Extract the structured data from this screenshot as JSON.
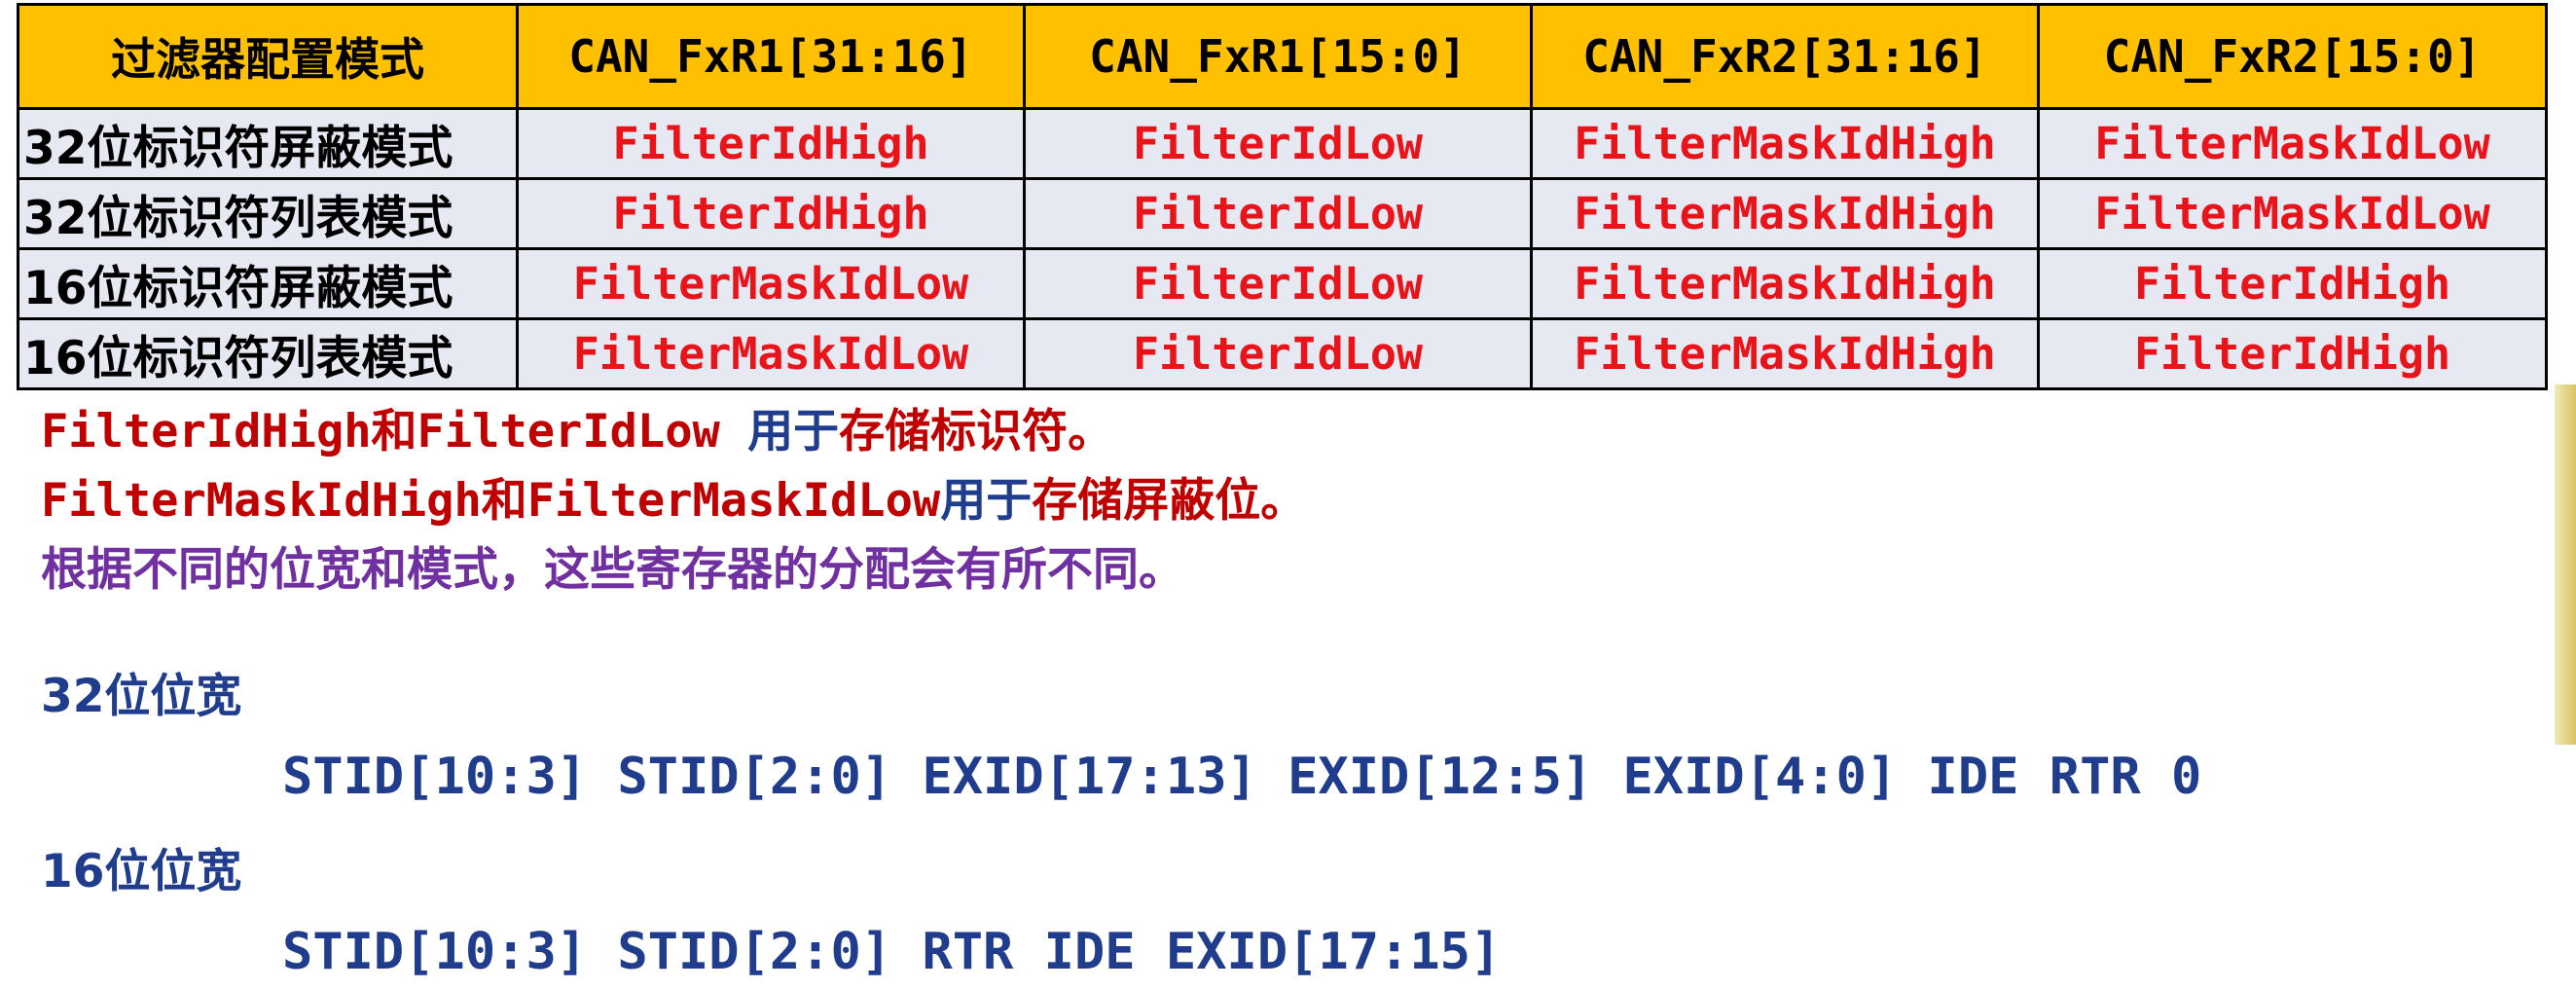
{
  "table": {
    "headers": [
      "过滤器配置模式",
      "CAN_FxR1[31:16]",
      "CAN_FxR1[15:0]",
      "CAN_FxR2[31:16]",
      "CAN_FxR2[15:0]"
    ],
    "rows": [
      {
        "mode": "32位标识符屏蔽模式",
        "cells": [
          "FilterIdHigh",
          "FilterIdLow",
          "FilterMaskIdHigh",
          "FilterMaskIdLow"
        ]
      },
      {
        "mode": "32位标识符列表模式",
        "cells": [
          "FilterIdHigh",
          "FilterIdLow",
          "FilterMaskIdHigh",
          "FilterMaskIdLow"
        ]
      },
      {
        "mode": "16位标识符屏蔽模式",
        "cells": [
          "FilterMaskIdLow",
          "FilterIdLow",
          "FilterMaskIdHigh",
          "FilterIdHigh"
        ]
      },
      {
        "mode": "16位标识符列表模式",
        "cells": [
          "FilterMaskIdLow",
          "FilterIdLow",
          "FilterMaskIdHigh",
          "FilterIdHigh"
        ]
      }
    ]
  },
  "notes": {
    "line1": {
      "a": "FilterIdHigh和FilterIdLow ",
      "b": "用于",
      "c": "存储标识符。"
    },
    "line2": {
      "a": "FilterMaskIdHigh和FilterMaskIdLow",
      "b": "用于",
      "c": "存储屏蔽位。"
    },
    "line3": "根据不同的位宽和模式，这些寄存器的分配会有所不同。"
  },
  "widths": {
    "w32_title": "32位位宽",
    "w32_bits": "STID[10:3] STID[2:0] EXID[17:13] EXID[12:5] EXID[4:0] IDE RTR 0",
    "w16_title": "16位位宽",
    "w16_bits": "STID[10:3] STID[2:0] RTR IDE EXID[17:15]"
  },
  "colors": {
    "header_bg": "#FFC000",
    "cell_bg": "#E6E8F2",
    "cell_text": "#E8141A",
    "note_red": "#C00000",
    "note_navy": "#1F3D8C",
    "note_purple": "#7030A0"
  }
}
